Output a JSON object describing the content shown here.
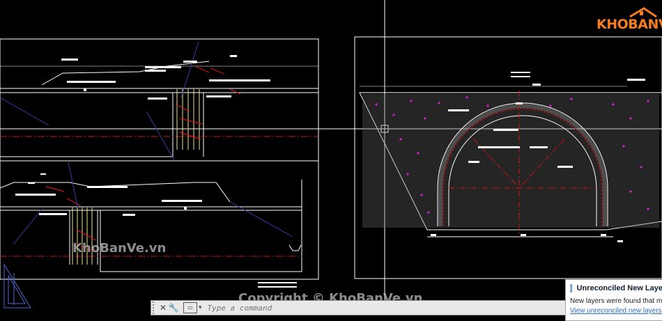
{
  "brand": {
    "logo_text": "KHOBANVE",
    "colors": {
      "orange": "#f57c1f"
    }
  },
  "watermarks": {
    "left": "KhoBanVe.vn",
    "bottom": "Copyright © KhoBanVe.vn"
  },
  "command_line": {
    "placeholder": "Type a command",
    "close_icon": "close-icon",
    "customize_icon": "wrench-icon",
    "prompt_icon": "command-prompt-icon"
  },
  "notification": {
    "title": "Unreconciled New Layers",
    "body": "New layers were found that ma",
    "link": "View unreconciled new layers in"
  },
  "drawing_colors": {
    "background": "#000000",
    "linework": "#ffffff",
    "centerline": "#d01515",
    "dimension": "#f0e68c",
    "hatch_point": "#d020d0",
    "leader": "#3a3aa8"
  }
}
